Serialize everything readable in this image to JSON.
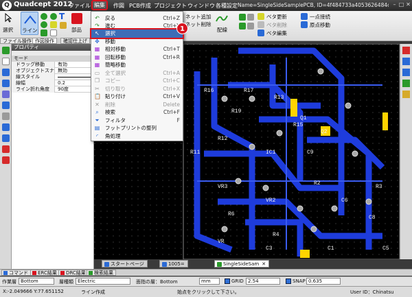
{
  "app": {
    "title": "Quadcept 2012",
    "doc_title": "Name=SingleSideSamplePCB, ID=4f484733a4053626484cc272, No-...",
    "menus": [
      "ファイル",
      "編集",
      "作図",
      "PCB作成",
      "プロジェクト",
      "ウィンドウ",
      "各種設定"
    ]
  },
  "ribbon": {
    "select": "選択",
    "line": "ライン",
    "component": "部品",
    "arrange": "配線",
    "net_add": "ネット追加",
    "net_delete": "ネット削除",
    "beta_update": "ベタ更新",
    "beta_delete": "ベタ削除",
    "beta_edit": "ベタ編集",
    "point_snap": "一点接続",
    "origin_move": "原点移動"
  },
  "panel_tabs": [
    "ファイル操作",
    "作図操作",
    "確認仕上げ"
  ],
  "properties": {
    "header": "プロパティ",
    "section": "モード",
    "rows": [
      {
        "label": "ドラッグ移動",
        "value": "有効"
      },
      {
        "label": "オブジェクトスナ",
        "value": "無効"
      },
      {
        "label": "線スタイル",
        "value": ""
      },
      {
        "label": "線幅",
        "value": "0.2"
      },
      {
        "label": "ライン折れ角度",
        "value": "90度"
      }
    ]
  },
  "edit_menu": {
    "items": [
      {
        "label": "戻る",
        "shortcut": "Ctrl+Z",
        "disabled": false,
        "icon": "undo-icon",
        "glyph": "↶",
        "color": "#2a8a2a"
      },
      {
        "label": "進む",
        "shortcut": "Ctrl+Y",
        "disabled": false,
        "icon": "redo-icon",
        "glyph": "↷",
        "color": "#2a8a2a"
      },
      {
        "label": "選択",
        "shortcut": "",
        "disabled": false,
        "icon": "select-cursor-icon",
        "glyph": "↖",
        "color": "#ffffff"
      },
      {
        "label": "移動",
        "shortcut": "",
        "disabled": false,
        "icon": "move-icon",
        "glyph": "✥",
        "color": "#2a6ad6"
      },
      {
        "label": "相対移動",
        "shortcut": "Ctrl+T",
        "disabled": false,
        "icon": "relative-move-icon",
        "glyph": "▦",
        "color": "#a02ad6"
      },
      {
        "label": "回転移動",
        "shortcut": "Ctrl+R",
        "disabled": false,
        "icon": "rotate-move-icon",
        "glyph": "▦",
        "color": "#a02ad6"
      },
      {
        "label": "簡略移動",
        "shortcut": "",
        "disabled": false,
        "icon": "simple-move-icon",
        "glyph": "▦",
        "color": "#a02ad6"
      },
      {
        "label": "全て選択",
        "shortcut": "Ctrl+A",
        "disabled": true,
        "icon": "select-all-icon",
        "glyph": "▭",
        "color": "#9a9a9a"
      },
      {
        "label": "コピー",
        "shortcut": "Ctrl+C",
        "disabled": true,
        "icon": "copy-icon",
        "glyph": "❐",
        "color": "#9a9a9a"
      },
      {
        "label": "切り取り",
        "shortcut": "Ctrl+X",
        "disabled": true,
        "icon": "cut-icon",
        "glyph": "✂",
        "color": "#9a9a9a"
      },
      {
        "label": "貼り付け",
        "shortcut": "Ctrl+V",
        "disabled": false,
        "icon": "paste-icon",
        "glyph": "📋",
        "color": "#c08020"
      },
      {
        "label": "削除",
        "shortcut": "Delete",
        "disabled": true,
        "icon": "delete-icon",
        "glyph": "✕",
        "color": "#9a9a9a"
      },
      {
        "label": "検索",
        "shortcut": "Ctrl+F",
        "disabled": false,
        "icon": "search-icon",
        "glyph": "⌕",
        "color": "#2a6ad6"
      },
      {
        "label": "フィルタ",
        "shortcut": "F",
        "disabled": false,
        "icon": "filter-icon",
        "glyph": "⏷",
        "color": "#2a6ad6"
      },
      {
        "label": "フットプリントの整列",
        "shortcut": "",
        "disabled": false,
        "icon": "footprint-align-icon",
        "glyph": "▤",
        "color": "#2a6ad6"
      },
      {
        "label": "角処理",
        "shortcut": "",
        "disabled": false,
        "icon": "corner-icon",
        "glyph": "◜",
        "color": "#2a6ad6"
      }
    ],
    "callout": "1"
  },
  "doc_tabs": [
    {
      "label": "スタートページ",
      "active": false,
      "color": "#2a6ad6"
    },
    {
      "label": "1005=",
      "active": false,
      "color": "#2a6ad6"
    },
    {
      "label": "SingleSideSam",
      "active": true,
      "color": "#2a9a2a"
    }
  ],
  "pcb_labels": [
    "R16",
    "R17",
    "R19",
    "R13",
    "R15",
    "R12",
    "R11",
    "C9",
    "Q1",
    "Q2",
    "IC1",
    "VR3",
    "VR2",
    "C6",
    "R6",
    "R4",
    "R2",
    "R3",
    "C8",
    "VR",
    "C3",
    "C1",
    "C5"
  ],
  "bottom_tabs": [
    {
      "label": "コマンド",
      "color": "#2a6ad6"
    },
    {
      "label": "ERC結果",
      "color": "#d8141f"
    },
    {
      "label": "DRC結果",
      "color": "#d8141f"
    },
    {
      "label": "検索結果",
      "color": "#2a9a2a"
    }
  ],
  "options": {
    "layer_label": "作業層",
    "layer_value": "Bottom",
    "type_label": "層種類",
    "type_value": "Electric",
    "view_label": "面指の層：Bottom",
    "unit_value": "mm",
    "grid_label": "GRID",
    "grid_value": "2.54",
    "snap_label": "SNAP",
    "snap_value": "0.635"
  },
  "status": {
    "coords": "X:-2.049666   Y:77.651152",
    "mode": "ライン作成",
    "hint": "始点をクリックして下さい。",
    "user": "User ID：Chinatsu"
  }
}
